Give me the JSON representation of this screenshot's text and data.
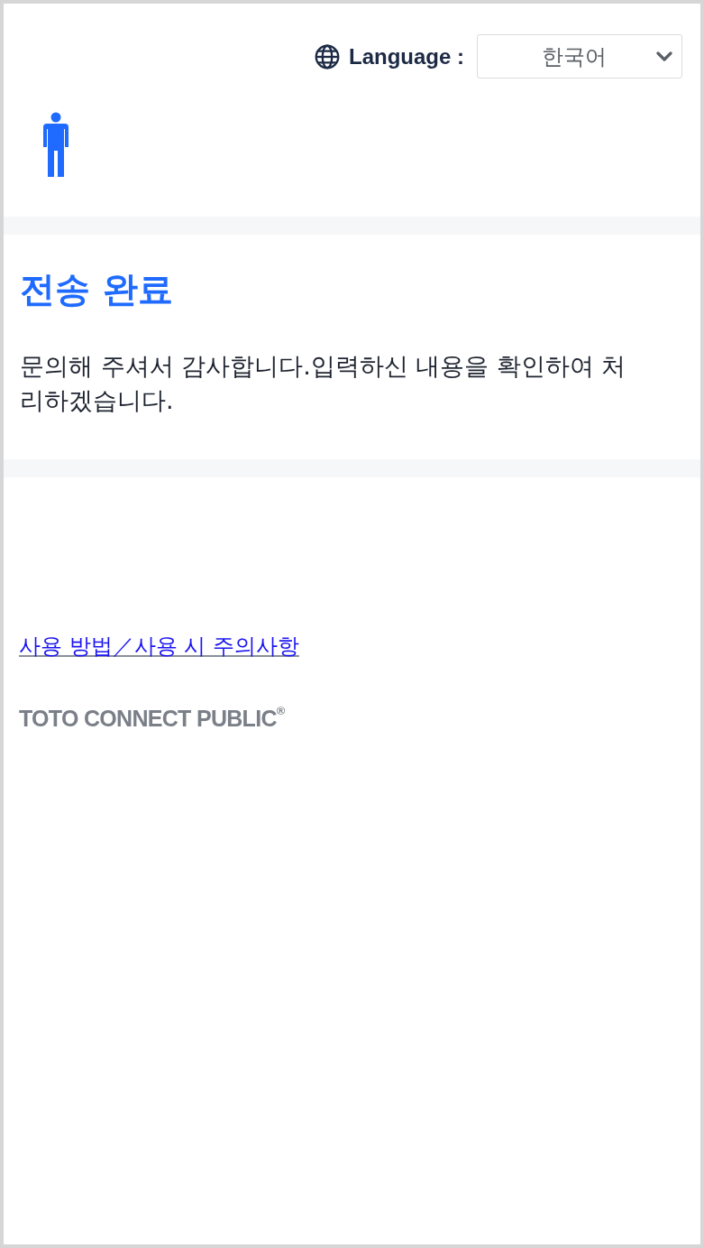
{
  "header": {
    "language_label": "Language :",
    "language_select": {
      "value": "한국어"
    }
  },
  "message": {
    "title": "전송 완료",
    "body": "문의해 주셔서 감사합니다.입력하신 내용을 확인하여 처리하겠습니다."
  },
  "footer": {
    "link": "사용 방법／사용 시 주의사항",
    "brand": "TOTO CONNECT PUBLIC$^{®}$"
  }
}
